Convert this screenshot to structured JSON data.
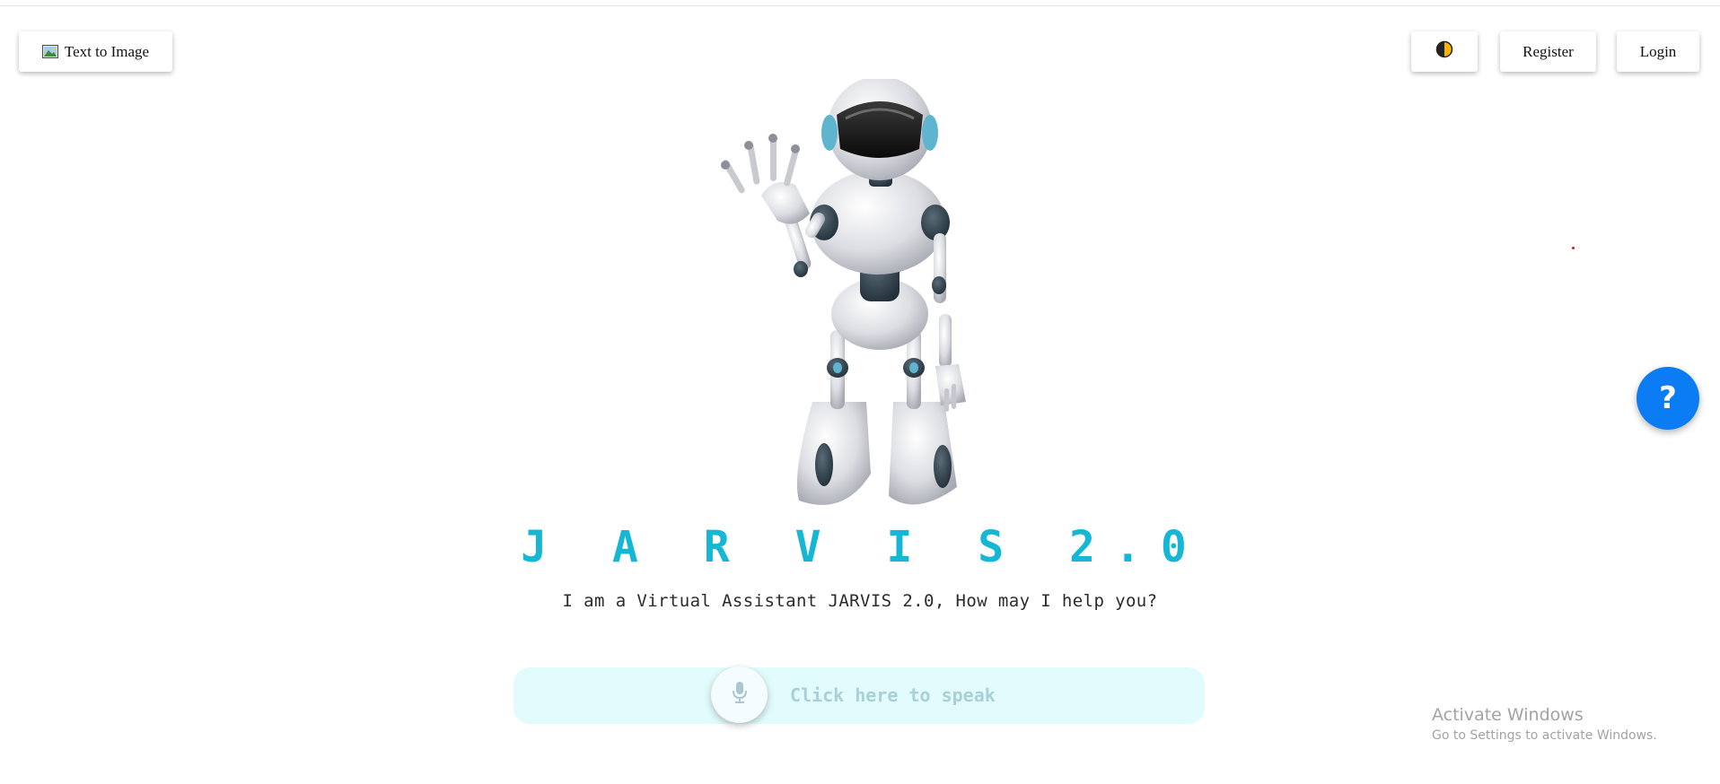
{
  "header": {
    "text_to_image_label": "Text to Image",
    "theme_toggle_icon": "half-moon-icon",
    "register_label": "Register",
    "login_label": "Login"
  },
  "hero": {
    "robot_image": "waving-robot-illustration",
    "title": "J A R V I S 2.0",
    "subtitle": "I am a Virtual Assistant JARVIS 2.0, How may I help you?"
  },
  "speak": {
    "mic_icon": "microphone-icon",
    "label": "Click here to speak"
  },
  "help_button": {
    "label": "?"
  },
  "os_watermark": {
    "title": "Activate Windows",
    "subtitle": "Go to Settings to activate Windows."
  },
  "colors": {
    "accent": "#16b7d4",
    "help_blue": "#0b7cf3",
    "speak_bar": "#e2fbfd",
    "theme_icon": "#f4b400"
  }
}
